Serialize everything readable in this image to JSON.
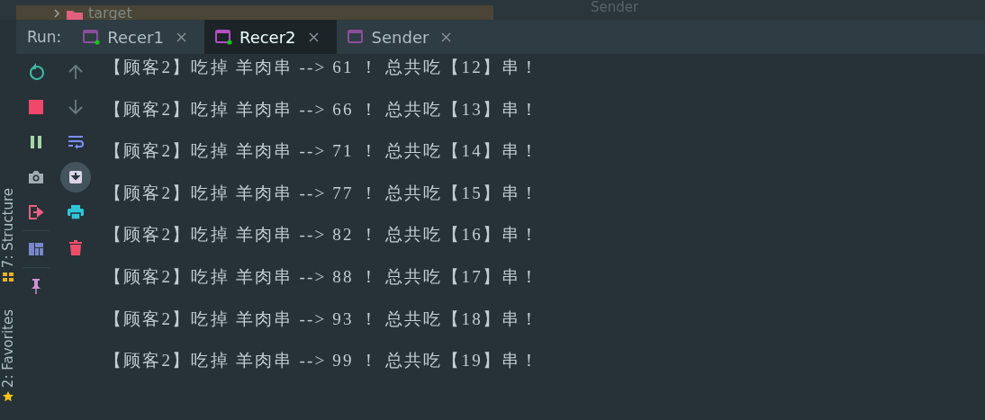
{
  "project_tree": {
    "row": {
      "label": "target",
      "expanded": false
    }
  },
  "editor_header": {
    "title": "Sender"
  },
  "run_panel": {
    "label": "Run:",
    "tabs": [
      {
        "label": "Recer1",
        "selected": false,
        "running": true
      },
      {
        "label": "Recer2",
        "selected": true,
        "running": true
      },
      {
        "label": "Sender",
        "selected": false,
        "running": false
      }
    ]
  },
  "side_stripe": [
    {
      "label": "7: Structure",
      "kind": "structure"
    },
    {
      "label": "2: Favorites",
      "kind": "favorites"
    }
  ],
  "toolbar_left": [
    {
      "kind": "rerun"
    },
    {
      "kind": "stop"
    },
    {
      "kind": "pause"
    },
    {
      "kind": "camera"
    },
    {
      "kind": "exit"
    },
    {
      "kind": "divider"
    },
    {
      "kind": "layout"
    },
    {
      "kind": "divider"
    },
    {
      "kind": "pin"
    }
  ],
  "toolbar_right": [
    {
      "kind": "up",
      "on": false
    },
    {
      "kind": "down",
      "on": false
    },
    {
      "kind": "wrap",
      "on": false
    },
    {
      "kind": "scroll-end",
      "on": true
    },
    {
      "kind": "print",
      "on": false
    },
    {
      "kind": "trash",
      "on": false
    }
  ],
  "console": [
    "【顾客2】吃掉 羊肉串 --> 61 ！ 总共吃【12】串！",
    "【顾客2】吃掉 羊肉串 --> 66 ！ 总共吃【13】串！",
    "【顾客2】吃掉 羊肉串 --> 71 ！ 总共吃【14】串！",
    "【顾客2】吃掉 羊肉串 --> 77 ！ 总共吃【15】串！",
    "【顾客2】吃掉 羊肉串 --> 82 ！ 总共吃【16】串！",
    "【顾客2】吃掉 羊肉串 --> 88 ！ 总共吃【17】串！",
    "【顾客2】吃掉 羊肉串 --> 93 ！ 总共吃【18】串！",
    "【顾客2】吃掉 羊肉串 --> 99 ！ 总共吃【19】串！"
  ]
}
